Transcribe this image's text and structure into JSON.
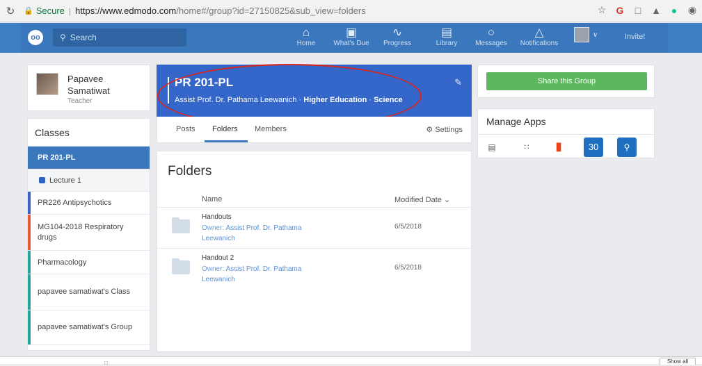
{
  "browser": {
    "secure_label": "Secure",
    "url_host": "https://www.edmodo.com",
    "url_path": "/home#/group?id=27150825&sub_view=folders"
  },
  "nav": {
    "search_placeholder": "Search",
    "items": [
      {
        "label": "Home",
        "icon": "home-icon"
      },
      {
        "label": "What's Due",
        "icon": "calendar-icon"
      },
      {
        "label": "Progress",
        "icon": "progress-icon"
      },
      {
        "label": "Library",
        "icon": "library-icon"
      },
      {
        "label": "Messages",
        "icon": "messages-icon"
      },
      {
        "label": "Notifications",
        "icon": "bell-icon"
      }
    ],
    "invite_label": "Invite!"
  },
  "profile": {
    "name": "Papavee Samatiwat",
    "role": "Teacher"
  },
  "classes": {
    "title": "Classes",
    "items": [
      {
        "label": "PR 201-PL",
        "active": true,
        "color": "#3b77bd"
      },
      {
        "label": "Lecture 1",
        "sub": true,
        "color": "#2f64c7"
      },
      {
        "label": "PR226 Antipsychotics",
        "color": "#3a62c4"
      },
      {
        "label": "MG104-2018 Respiratory drugs",
        "color": "#e8583a"
      },
      {
        "label": "Pharmacology",
        "color": "#26a69a"
      },
      {
        "label": "papavee samatiwat's Class",
        "color": "#26a69a"
      },
      {
        "label": "papavee samatiwat's Group",
        "color": "#26a69a"
      }
    ]
  },
  "group": {
    "title": "PR 201-PL",
    "owner": "Assist Prof. Dr. Pathama Leewanich",
    "level": "Higher Education",
    "subject": "Science",
    "header_color": "#3566c9"
  },
  "tabs": {
    "posts": "Posts",
    "folders": "Folders",
    "members": "Members",
    "settings": "Settings"
  },
  "folders": {
    "title": "Folders",
    "col_name": "Name",
    "col_modified": "Modified Date",
    "owner_label": "Owner:",
    "rows": [
      {
        "name": "Handouts",
        "owner": "Assist Prof. Dr. Pathama Leewanich",
        "date": "6/5/2018"
      },
      {
        "name": "Handout 2",
        "owner": "Assist Prof. Dr. Pathama Leewanich",
        "date": "6/5/2018"
      }
    ]
  },
  "right": {
    "share_label": "Share this Group",
    "share_color": "#5cb85c",
    "apps_title": "Manage Apps",
    "apps": [
      {
        "icon": "store-icon",
        "color": "#555555"
      },
      {
        "icon": "grid-icon",
        "color": "#555555"
      },
      {
        "icon": "office-icon",
        "color": "#e8431a"
      },
      {
        "icon": "calendar-30-icon",
        "color": "#1e6fbf",
        "text": "30"
      },
      {
        "icon": "quiz-search-icon",
        "color": "#1e6fbf"
      }
    ]
  },
  "downloads": {
    "show_all": "Show all"
  }
}
